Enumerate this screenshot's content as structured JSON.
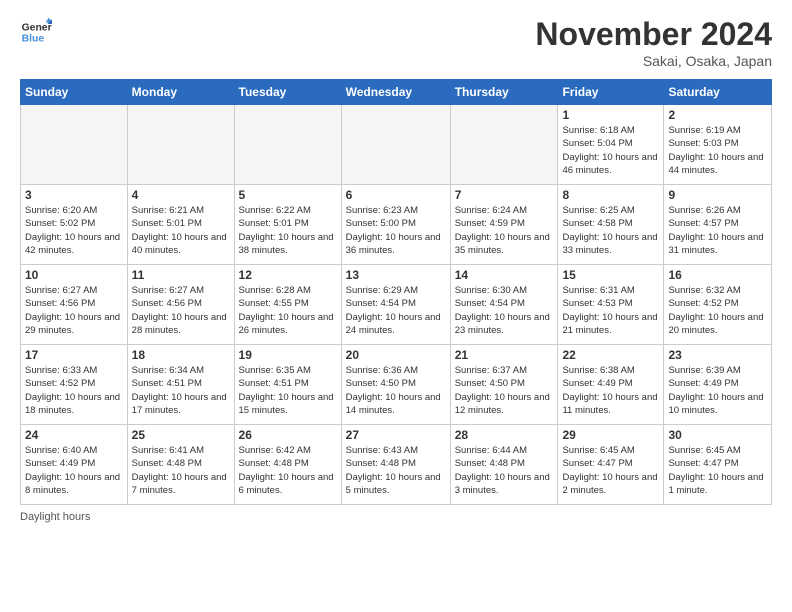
{
  "header": {
    "logo_line1": "General",
    "logo_line2": "Blue",
    "month_title": "November 2024",
    "location": "Sakai, Osaka, Japan"
  },
  "calendar": {
    "days_of_week": [
      "Sunday",
      "Monday",
      "Tuesday",
      "Wednesday",
      "Thursday",
      "Friday",
      "Saturday"
    ],
    "weeks": [
      [
        {
          "day": "",
          "info": "",
          "empty": true
        },
        {
          "day": "",
          "info": "",
          "empty": true
        },
        {
          "day": "",
          "info": "",
          "empty": true
        },
        {
          "day": "",
          "info": "",
          "empty": true
        },
        {
          "day": "",
          "info": "",
          "empty": true
        },
        {
          "day": "1",
          "info": "Sunrise: 6:18 AM\nSunset: 5:04 PM\nDaylight: 10 hours and 46 minutes."
        },
        {
          "day": "2",
          "info": "Sunrise: 6:19 AM\nSunset: 5:03 PM\nDaylight: 10 hours and 44 minutes."
        }
      ],
      [
        {
          "day": "3",
          "info": "Sunrise: 6:20 AM\nSunset: 5:02 PM\nDaylight: 10 hours and 42 minutes."
        },
        {
          "day": "4",
          "info": "Sunrise: 6:21 AM\nSunset: 5:01 PM\nDaylight: 10 hours and 40 minutes."
        },
        {
          "day": "5",
          "info": "Sunrise: 6:22 AM\nSunset: 5:01 PM\nDaylight: 10 hours and 38 minutes."
        },
        {
          "day": "6",
          "info": "Sunrise: 6:23 AM\nSunset: 5:00 PM\nDaylight: 10 hours and 36 minutes."
        },
        {
          "day": "7",
          "info": "Sunrise: 6:24 AM\nSunset: 4:59 PM\nDaylight: 10 hours and 35 minutes."
        },
        {
          "day": "8",
          "info": "Sunrise: 6:25 AM\nSunset: 4:58 PM\nDaylight: 10 hours and 33 minutes."
        },
        {
          "day": "9",
          "info": "Sunrise: 6:26 AM\nSunset: 4:57 PM\nDaylight: 10 hours and 31 minutes."
        }
      ],
      [
        {
          "day": "10",
          "info": "Sunrise: 6:27 AM\nSunset: 4:56 PM\nDaylight: 10 hours and 29 minutes."
        },
        {
          "day": "11",
          "info": "Sunrise: 6:27 AM\nSunset: 4:56 PM\nDaylight: 10 hours and 28 minutes."
        },
        {
          "day": "12",
          "info": "Sunrise: 6:28 AM\nSunset: 4:55 PM\nDaylight: 10 hours and 26 minutes."
        },
        {
          "day": "13",
          "info": "Sunrise: 6:29 AM\nSunset: 4:54 PM\nDaylight: 10 hours and 24 minutes."
        },
        {
          "day": "14",
          "info": "Sunrise: 6:30 AM\nSunset: 4:54 PM\nDaylight: 10 hours and 23 minutes."
        },
        {
          "day": "15",
          "info": "Sunrise: 6:31 AM\nSunset: 4:53 PM\nDaylight: 10 hours and 21 minutes."
        },
        {
          "day": "16",
          "info": "Sunrise: 6:32 AM\nSunset: 4:52 PM\nDaylight: 10 hours and 20 minutes."
        }
      ],
      [
        {
          "day": "17",
          "info": "Sunrise: 6:33 AM\nSunset: 4:52 PM\nDaylight: 10 hours and 18 minutes."
        },
        {
          "day": "18",
          "info": "Sunrise: 6:34 AM\nSunset: 4:51 PM\nDaylight: 10 hours and 17 minutes."
        },
        {
          "day": "19",
          "info": "Sunrise: 6:35 AM\nSunset: 4:51 PM\nDaylight: 10 hours and 15 minutes."
        },
        {
          "day": "20",
          "info": "Sunrise: 6:36 AM\nSunset: 4:50 PM\nDaylight: 10 hours and 14 minutes."
        },
        {
          "day": "21",
          "info": "Sunrise: 6:37 AM\nSunset: 4:50 PM\nDaylight: 10 hours and 12 minutes."
        },
        {
          "day": "22",
          "info": "Sunrise: 6:38 AM\nSunset: 4:49 PM\nDaylight: 10 hours and 11 minutes."
        },
        {
          "day": "23",
          "info": "Sunrise: 6:39 AM\nSunset: 4:49 PM\nDaylight: 10 hours and 10 minutes."
        }
      ],
      [
        {
          "day": "24",
          "info": "Sunrise: 6:40 AM\nSunset: 4:49 PM\nDaylight: 10 hours and 8 minutes."
        },
        {
          "day": "25",
          "info": "Sunrise: 6:41 AM\nSunset: 4:48 PM\nDaylight: 10 hours and 7 minutes."
        },
        {
          "day": "26",
          "info": "Sunrise: 6:42 AM\nSunset: 4:48 PM\nDaylight: 10 hours and 6 minutes."
        },
        {
          "day": "27",
          "info": "Sunrise: 6:43 AM\nSunset: 4:48 PM\nDaylight: 10 hours and 5 minutes."
        },
        {
          "day": "28",
          "info": "Sunrise: 6:44 AM\nSunset: 4:48 PM\nDaylight: 10 hours and 3 minutes."
        },
        {
          "day": "29",
          "info": "Sunrise: 6:45 AM\nSunset: 4:47 PM\nDaylight: 10 hours and 2 minutes."
        },
        {
          "day": "30",
          "info": "Sunrise: 6:45 AM\nSunset: 4:47 PM\nDaylight: 10 hours and 1 minute."
        }
      ]
    ]
  },
  "footer": {
    "note": "Daylight hours"
  }
}
